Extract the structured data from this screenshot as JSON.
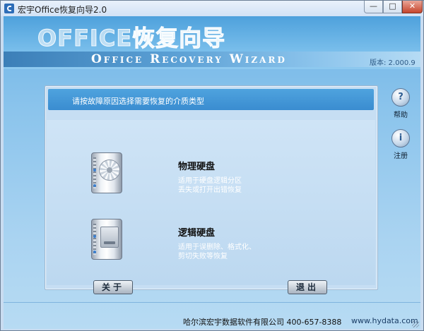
{
  "window": {
    "title": "宏宇Office恢复向导2.0",
    "controls": {
      "minimize": "—",
      "maximize": "□",
      "close": "✕"
    }
  },
  "header": {
    "title_cn": "OFFICE恢复向导",
    "title_en": "Office Recovery Wizard",
    "version": "版本: 2.000.9"
  },
  "panel": {
    "prompt": "请按故障原因选择需要恢复的介质类型",
    "options": [
      {
        "title": "物理硬盘",
        "desc_lines": [
          "适用于硬盘逻辑分区",
          "丢失或打开出错恢复"
        ],
        "icon": "hard-drive-disc-icon"
      },
      {
        "title": "逻辑硬盘",
        "desc_lines": [
          "适用于误删除、格式化、",
          "剪切失败等恢复"
        ],
        "icon": "hard-drive-slot-icon"
      }
    ]
  },
  "side_buttons": [
    {
      "label": "帮助",
      "glyph": "?",
      "icon": "help-icon"
    },
    {
      "label": "注册",
      "glyph": "i",
      "icon": "register-icon"
    }
  ],
  "buttons": {
    "about": "关于",
    "exit": "退出"
  },
  "footer": {
    "company": "哈尔滨宏宇数据软件有限公司  400-657-8388",
    "url": "www.hydata.com"
  }
}
